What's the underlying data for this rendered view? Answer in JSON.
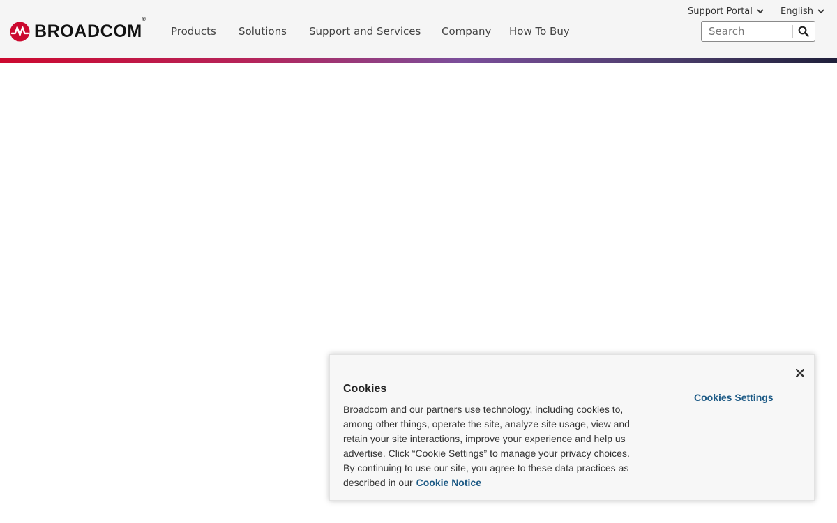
{
  "brand": {
    "name": "BROADCOM",
    "trademark": "®",
    "accent_color": "#cc092f"
  },
  "nav": {
    "items": [
      {
        "label": "Products"
      },
      {
        "label": "Solutions"
      },
      {
        "label": "Support and Services"
      },
      {
        "label": "Company"
      },
      {
        "label": "How To Buy"
      }
    ]
  },
  "utility": {
    "support_portal": "Support Portal",
    "language": "English",
    "chevron_icon": "chevron-down-icon"
  },
  "search": {
    "placeholder": "Search",
    "value": "",
    "icon": "search-icon"
  },
  "cookie_banner": {
    "title": "Cookies",
    "body": "Broadcom and our partners use technology, including cookies to, among other things, operate the site, analyze site usage, view and retain your site interactions, improve your experience and help us advertise. Click “Cookie Settings” to manage your privacy choices. By continuing to use our site, you agree to these data practices as described in our",
    "notice_link": "Cookie Notice",
    "settings_label": "Cookies Settings",
    "close_icon": "close-icon",
    "link_color": "#1e5b86"
  }
}
